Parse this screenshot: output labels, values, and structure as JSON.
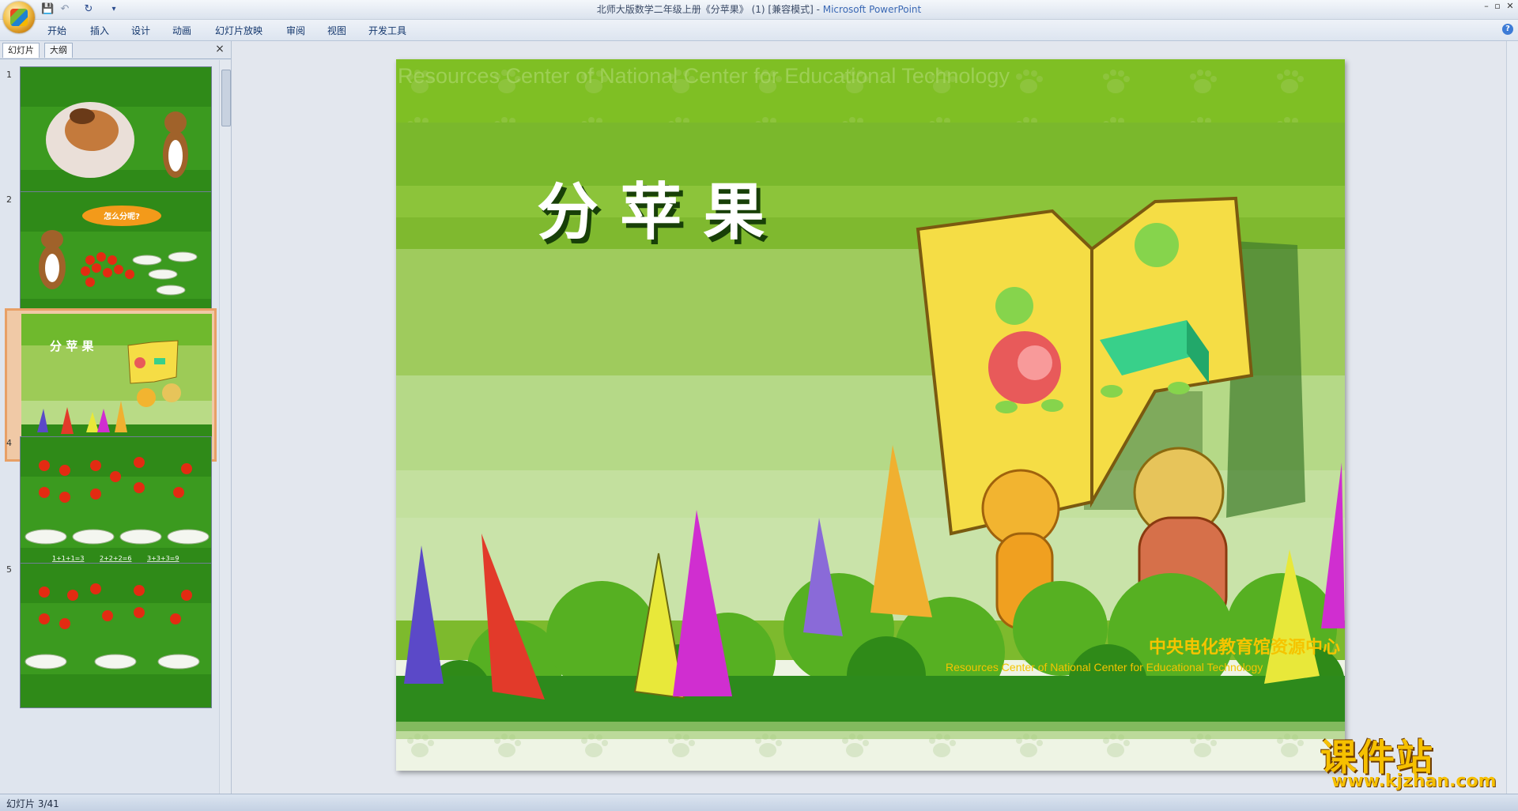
{
  "window": {
    "title_doc": "北师大版数学二年级上册《分苹果》 (1) [兼容模式]",
    "title_sep": " - ",
    "title_app": "Microsoft PowerPoint",
    "min": "–",
    "max": "▫",
    "close": "✕"
  },
  "quick_access": {
    "save": "💾",
    "undo": "↶",
    "redo": "↻",
    "more": "▾"
  },
  "ribbon": {
    "tabs": [
      "开始",
      "插入",
      "设计",
      "动画",
      "幻灯片放映",
      "审阅",
      "视图",
      "开发工具"
    ],
    "help": "?"
  },
  "left_pane": {
    "tabs": [
      "幻灯片",
      "大纲"
    ],
    "close": "×",
    "slides": [
      {
        "num": "1"
      },
      {
        "num": "2",
        "bubble": "怎么分呢?"
      },
      {
        "num": "3",
        "title": "分 苹 果"
      },
      {
        "num": "4",
        "labels": [
          "1+1+1=3",
          "2+2+2=6",
          "3+3+3=9"
        ]
      },
      {
        "num": "5"
      }
    ]
  },
  "slide": {
    "title": "分 苹 果",
    "header_watermark": "Resources Center of National Center for Educational Technology",
    "footer_cn": "中央电化教育馆资源中心",
    "footer_en": "Resources Center of National Center for Educational Technology"
  },
  "status": {
    "text": "幻灯片 3/41"
  },
  "watermark": {
    "title": "课件站",
    "url": "www.kjzhan.com"
  },
  "colors": {
    "accent": "#3a68b4",
    "slide_green": "#5fae25",
    "selected_border": "#e8a066"
  }
}
